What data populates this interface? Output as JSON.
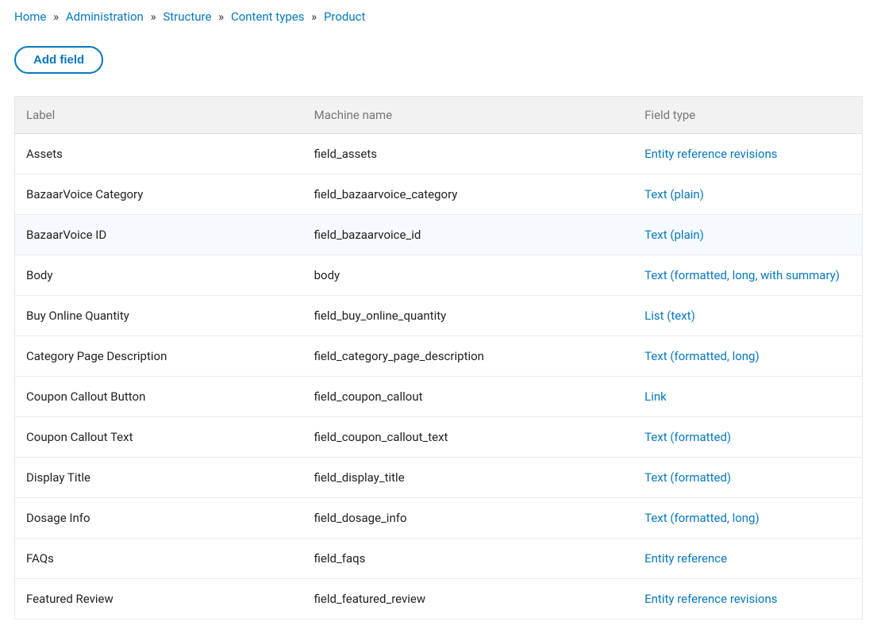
{
  "breadcrumb": {
    "items": [
      {
        "label": "Home"
      },
      {
        "label": "Administration"
      },
      {
        "label": "Structure"
      },
      {
        "label": "Content types"
      },
      {
        "label": "Product"
      }
    ]
  },
  "add_field_button": "Add field",
  "table": {
    "headers": {
      "label": "Label",
      "machine_name": "Machine name",
      "field_type": "Field type"
    },
    "rows": [
      {
        "label": "Assets",
        "machine_name": "field_assets",
        "field_type": "Entity reference revisions",
        "highlight": false
      },
      {
        "label": "BazaarVoice Category",
        "machine_name": "field_bazaarvoice_category",
        "field_type": "Text (plain)",
        "highlight": false
      },
      {
        "label": "BazaarVoice ID",
        "machine_name": "field_bazaarvoice_id",
        "field_type": "Text (plain)",
        "highlight": true
      },
      {
        "label": "Body",
        "machine_name": "body",
        "field_type": "Text (formatted, long, with summary)",
        "highlight": false
      },
      {
        "label": "Buy Online Quantity",
        "machine_name": "field_buy_online_quantity",
        "field_type": "List (text)",
        "highlight": false
      },
      {
        "label": "Category Page Description",
        "machine_name": "field_category_page_description",
        "field_type": "Text (formatted, long)",
        "highlight": false
      },
      {
        "label": "Coupon Callout Button",
        "machine_name": "field_coupon_callout",
        "field_type": "Link",
        "highlight": false
      },
      {
        "label": "Coupon Callout Text",
        "machine_name": "field_coupon_callout_text",
        "field_type": "Text (formatted)",
        "highlight": false
      },
      {
        "label": "Display Title",
        "machine_name": "field_display_title",
        "field_type": "Text (formatted)",
        "highlight": false
      },
      {
        "label": "Dosage Info",
        "machine_name": "field_dosage_info",
        "field_type": "Text (formatted, long)",
        "highlight": false
      },
      {
        "label": "FAQs",
        "machine_name": "field_faqs",
        "field_type": "Entity reference",
        "highlight": false
      },
      {
        "label": "Featured Review",
        "machine_name": "field_featured_review",
        "field_type": "Entity reference revisions",
        "highlight": false
      }
    ]
  }
}
